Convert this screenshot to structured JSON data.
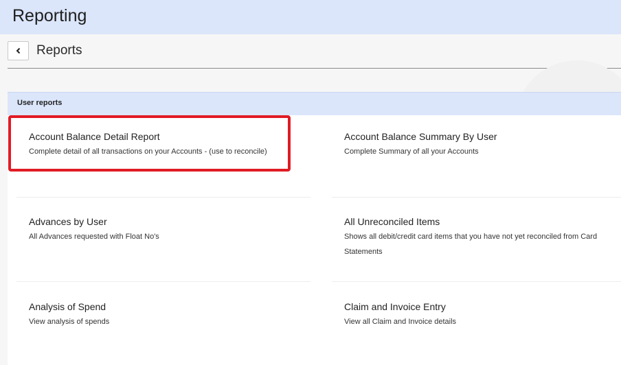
{
  "app": {
    "title": "Reporting"
  },
  "header": {
    "page_title": "Reports",
    "back_icon": "chevron-left-icon"
  },
  "section": {
    "label": "User reports"
  },
  "reports": [
    {
      "title": "Account Balance Detail Report",
      "description": "Complete detail of all transactions on your Accounts - (use to reconcile)"
    },
    {
      "title": "Account Balance Summary By User",
      "description": "Complete Summary of all your Accounts"
    },
    {
      "title": "Advances by User",
      "description": "All Advances requested with Float No's"
    },
    {
      "title": "All Unreconciled Items",
      "description": "Shows all debit/credit card items that you have not yet reconciled from Card Statements"
    },
    {
      "title": "Analysis of Spend",
      "description": "View analysis of spends"
    },
    {
      "title": "Claim and Invoice Entry",
      "description": "View all Claim and Invoice details"
    }
  ],
  "colors": {
    "header_bg": "#dbe6fb",
    "highlight": "#e01b24"
  }
}
